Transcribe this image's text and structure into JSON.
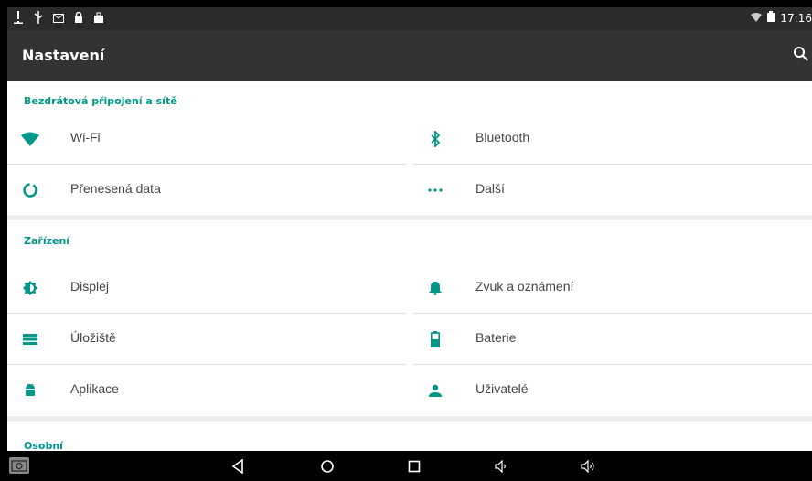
{
  "status_bar": {
    "left_icons": [
      "alert-icon",
      "usb-icon",
      "mail-icon",
      "lock-icon",
      "bag-icon"
    ],
    "time": "17:16"
  },
  "action_bar": {
    "title": "Nastavení"
  },
  "sections": [
    {
      "title": "Bezdrátová připojení a sítě",
      "items": [
        {
          "label": "Wi-Fi",
          "icon": "wifi-icon"
        },
        {
          "label": "Bluetooth",
          "icon": "bluetooth-icon"
        },
        {
          "label": "Přenesená data",
          "icon": "data-usage-icon"
        },
        {
          "label": "Další",
          "icon": "more-icon"
        }
      ]
    },
    {
      "title": "Zařízení",
      "items": [
        {
          "label": "Displej",
          "icon": "brightness-icon"
        },
        {
          "label": "Zvuk a oznámení",
          "icon": "bell-icon"
        },
        {
          "label": "Úložiště",
          "icon": "storage-icon"
        },
        {
          "label": "Baterie",
          "icon": "battery-icon"
        },
        {
          "label": "Aplikace",
          "icon": "android-icon"
        },
        {
          "label": "Uživatelé",
          "icon": "user-icon"
        }
      ]
    },
    {
      "title": "Osobní",
      "items": []
    }
  ],
  "colors": {
    "accent": "#009688",
    "action_bar": "#333333",
    "status_bar": "#2b2b2b"
  }
}
